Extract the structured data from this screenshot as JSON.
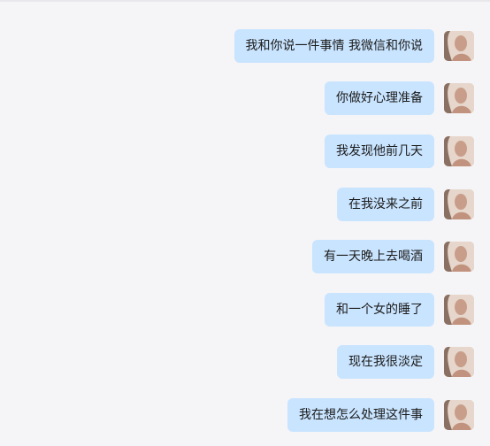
{
  "messages": [
    {
      "text": "我和你说一件事情 我微信和你说"
    },
    {
      "text": "你做好心理准备"
    },
    {
      "text": "我发现他前几天"
    },
    {
      "text": "在我没来之前"
    },
    {
      "text": "有一天晚上去喝酒"
    },
    {
      "text": "和一个女的睡了"
    },
    {
      "text": "现在我很淡定"
    },
    {
      "text": "我在想怎么处理这件事"
    }
  ],
  "colors": {
    "background": "#f5f5f7",
    "bubble": "#c9e4ff",
    "text": "#1b1b1b"
  },
  "icons": {
    "avatar": "user-avatar-photo"
  }
}
